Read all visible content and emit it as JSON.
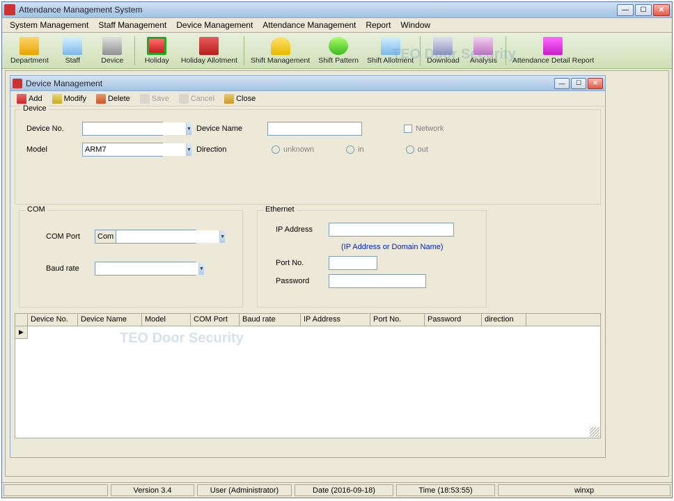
{
  "app": {
    "title": "Attendance Management System"
  },
  "menu": {
    "system": "System Management",
    "staff": "Staff Management",
    "device": "Device Management",
    "attendance": "Attendance Management",
    "report": "Report",
    "window": "Window"
  },
  "toolbar": {
    "department": "Department",
    "staff": "Staff",
    "device": "Device",
    "holiday": "Holiday",
    "holiday_allot": "Holiday Allotment",
    "shift_mgmt": "Shift Management",
    "shift_pattern": "Shift Pattern",
    "shift_allot": "Shift Allotment",
    "download": "Download",
    "analysis": "Analysis",
    "adr": "Attendance Detail Report"
  },
  "watermark": "TEO Door Security",
  "child": {
    "title": "Device Management",
    "btn": {
      "add": "Add",
      "modify": "Modify",
      "delete": "Delete",
      "save": "Save",
      "cancel": "Cancel",
      "close": "Close"
    },
    "group": {
      "device": "Device",
      "com": "COM",
      "ethernet": "Ethernet"
    },
    "field": {
      "device_no": "Device No.",
      "model": "Model",
      "device_name": "Device Name",
      "direction": "Direction",
      "direction_unknown": "unknown",
      "direction_in": "in",
      "direction_out": "out",
      "network": "Network",
      "com_port": "COM Port",
      "baud_rate": "Baud rate",
      "ip_address": "IP Address",
      "ip_hint": "(IP Address or Domain Name)",
      "port_no": "Port No.",
      "password": "Password"
    },
    "values": {
      "device_no": "",
      "model": "ARM7",
      "device_name": "",
      "com_port_prefix": "Com",
      "com_port": "",
      "baud_rate": "",
      "ip_address": "",
      "port_no": "",
      "password": ""
    },
    "grid": {
      "cols": {
        "device_no": "Device No.",
        "device_name": "Device Name",
        "model": "Model",
        "com_port": "COM Port",
        "baud_rate": "Baud rate",
        "ip_address": "IP Address",
        "port_no": "Port No.",
        "password": "Password",
        "direction": "direction"
      }
    }
  },
  "status": {
    "version": "Version 3.4",
    "user": "User (Administrator)",
    "date": "Date (2016-09-18)",
    "time": "Time (18:53:55)",
    "os": "winxp"
  }
}
